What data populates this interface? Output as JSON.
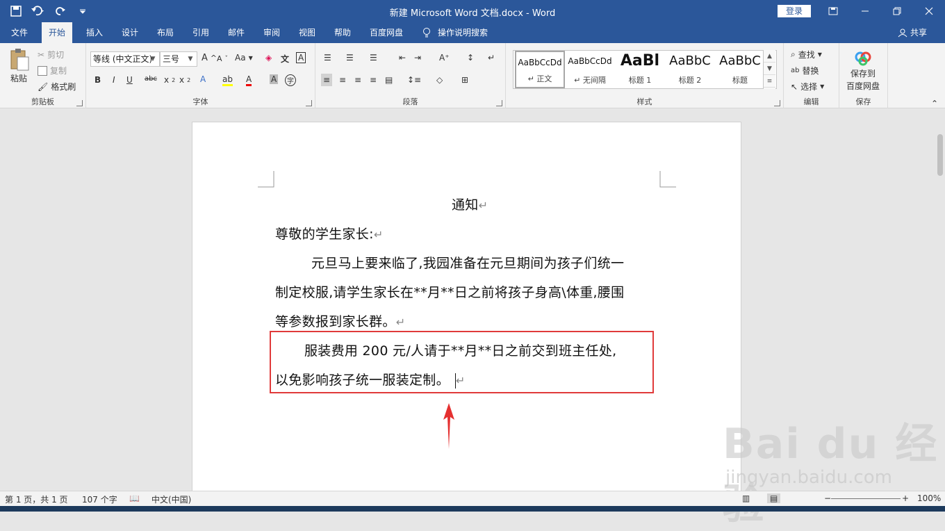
{
  "titlebar": {
    "doc_title": "新建 Microsoft Word 文档.docx - Word",
    "login": "登录"
  },
  "tabs": [
    "文件",
    "开始",
    "插入",
    "设计",
    "布局",
    "引用",
    "邮件",
    "审阅",
    "视图",
    "帮助",
    "百度网盘"
  ],
  "tell_me": "操作说明搜索",
  "share": "共享",
  "ribbon": {
    "clipboard": {
      "paste": "粘贴",
      "cut": "剪切",
      "copy": "复制",
      "format_painter": "格式刷",
      "label": "剪贴板"
    },
    "font": {
      "font_name": "等线 (中文正文)",
      "font_size": "三号",
      "label": "字体",
      "aa_label": "Aa"
    },
    "paragraph": {
      "label": "段落"
    },
    "styles": {
      "label": "样式",
      "items": [
        {
          "sample": "AaBbCcDd",
          "name": "↵ 正文"
        },
        {
          "sample": "AaBbCcDd",
          "name": "↵ 无间隔"
        },
        {
          "sample": "AaBl",
          "name": "标题 1"
        },
        {
          "sample": "AaBbC",
          "name": "标题 2"
        },
        {
          "sample": "AaBbC",
          "name": "标题"
        }
      ]
    },
    "editing": {
      "find": "查找",
      "replace": "替换",
      "select": "选择",
      "label": "编辑"
    },
    "save": {
      "save_to": "保存到",
      "baidu": "百度网盘",
      "label": "保存"
    }
  },
  "document": {
    "title": "通知",
    "salutation": "尊敬的学生家长:",
    "para1_line1": "元旦马上要来临了,我园准备在元旦期间为孩子们统一",
    "para1_line2": "制定校服,请学生家长在**月**日之前将孩子身高\\体重,腰围",
    "para1_line3": "等参数报到家长群。",
    "para2_line1": "服装费用 200 元/人请于**月**日之前交到班主任处,",
    "para2_line2": "以免影响孩子统一服装定制。",
    "return_mark": "↵"
  },
  "status": {
    "page": "第 1 页，共 1 页",
    "words": "107 个字",
    "language": "中文(中国)",
    "zoom": "100%"
  },
  "watermark": {
    "main": "Bai du 经验",
    "url": "jingyan.baidu.com"
  }
}
